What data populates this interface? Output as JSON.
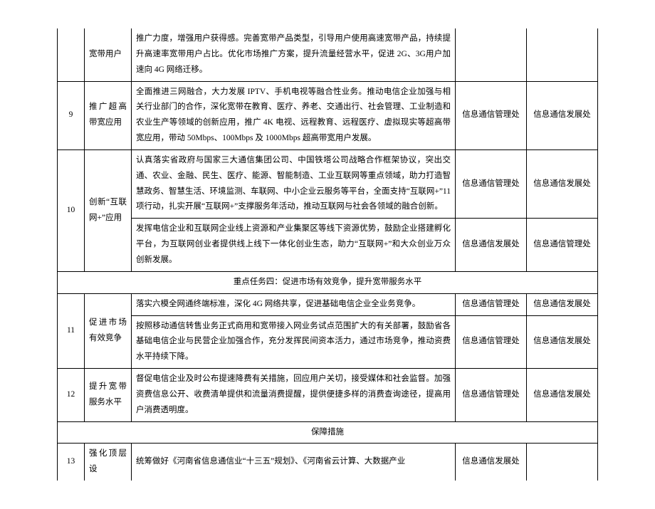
{
  "rows": {
    "r0": {
      "task": "宽带用户",
      "desc": "推广力度，增强用户获得感。完善宽带产品类型，引导用户使用高速宽带产品，持续提升高速率宽带用户占比。优化市场推广方案，提升流量经营水平，促进 2G、3G用户加速向 4G 网络迁移。"
    },
    "r9": {
      "num": "9",
      "task": "推广超高带宽应用",
      "desc": "全面推进三网融合，大力发展 IPTV、手机电视等融合性业务。推动电信企业加强与相关行业部门的合作，深化宽带在教育、医疗、养老、交通出行、社会管理、工业制造和农业生产等领域的创新应用，推广 4K 电视、远程教育、远程医疗、虚拟现实等超高带宽应用，带动 50Mbps、100Mbps 及 1000Mbps 超高带宽用户发展。",
      "dept1": "信息通信管理处",
      "dept2": "信息通信发展处"
    },
    "r10a": {
      "num": "10",
      "task": "创新“互联网+”应用",
      "desc": "认真落实省政府与国家三大通信集团公司、中国铁塔公司战略合作框架协议，突出交通、农业、金融、民生、医疗、能源、智能制造、工业互联网等重点领域，助力打造智慧政务、智慧生活、环境监测、车联网、中小企业云服务等平台，全面支持“互联网+”11 项行动，扎实开展“互联网+”支撑服务年活动，推动互联网与社会各领域的融合创新。",
      "dept1": "信息通信管理处",
      "dept2": "信息通信发展处"
    },
    "r10b": {
      "desc": "发挥电信企业和互联网企业线上资源和产业集聚区等线下资源优势，鼓励企业搭建孵化平台，为互联网创业者提供线上线下一体化创业生态，助力“互联网+”和大众创业万众创新发展。",
      "dept1": "信息通信发展处",
      "dept2": "信息通信管理处"
    },
    "section4": "重点任务四：促进市场有效竞争，提升宽带服务水平",
    "r11a": {
      "num": "11",
      "task": "促进市场有效竞争",
      "desc": "落实六模全网通终端标准，深化 4G 网络共享，促进基础电信企业全业务竞争。",
      "dept1": "信息通信管理处",
      "dept2": "信息通信发展处"
    },
    "r11b": {
      "desc": "按照移动通信转售业务正式商用和宽带接入网业务试点范围扩大的有关部署，鼓励省各基础电信企业与民营企业加强合作，充分发挥民间资本活力，通过市场竞争，推动资费水平持续下降。",
      "dept1": "信息通信管理处",
      "dept2": "信息通信发展处"
    },
    "r12": {
      "num": "12",
      "task": "提升宽带服务水平",
      "desc": "督促电信企业及时公布提速降费有关措施，回应用户关切，接受媒体和社会监督。加强资费信息公开、收费清单提供和流量消费提醒，提供便捷多样的消费查询途径，提高用户消费透明度。",
      "dept1": "信息通信管理处",
      "dept2": "信息通信发展处"
    },
    "section5": "保障措施",
    "r13": {
      "num": "13",
      "task": "强化顶层设",
      "desc": "统筹做好《河南省信息通信业“十三五”规划》、《河南省云计算、大数据产业",
      "dept1": "信息通信发展处"
    }
  }
}
